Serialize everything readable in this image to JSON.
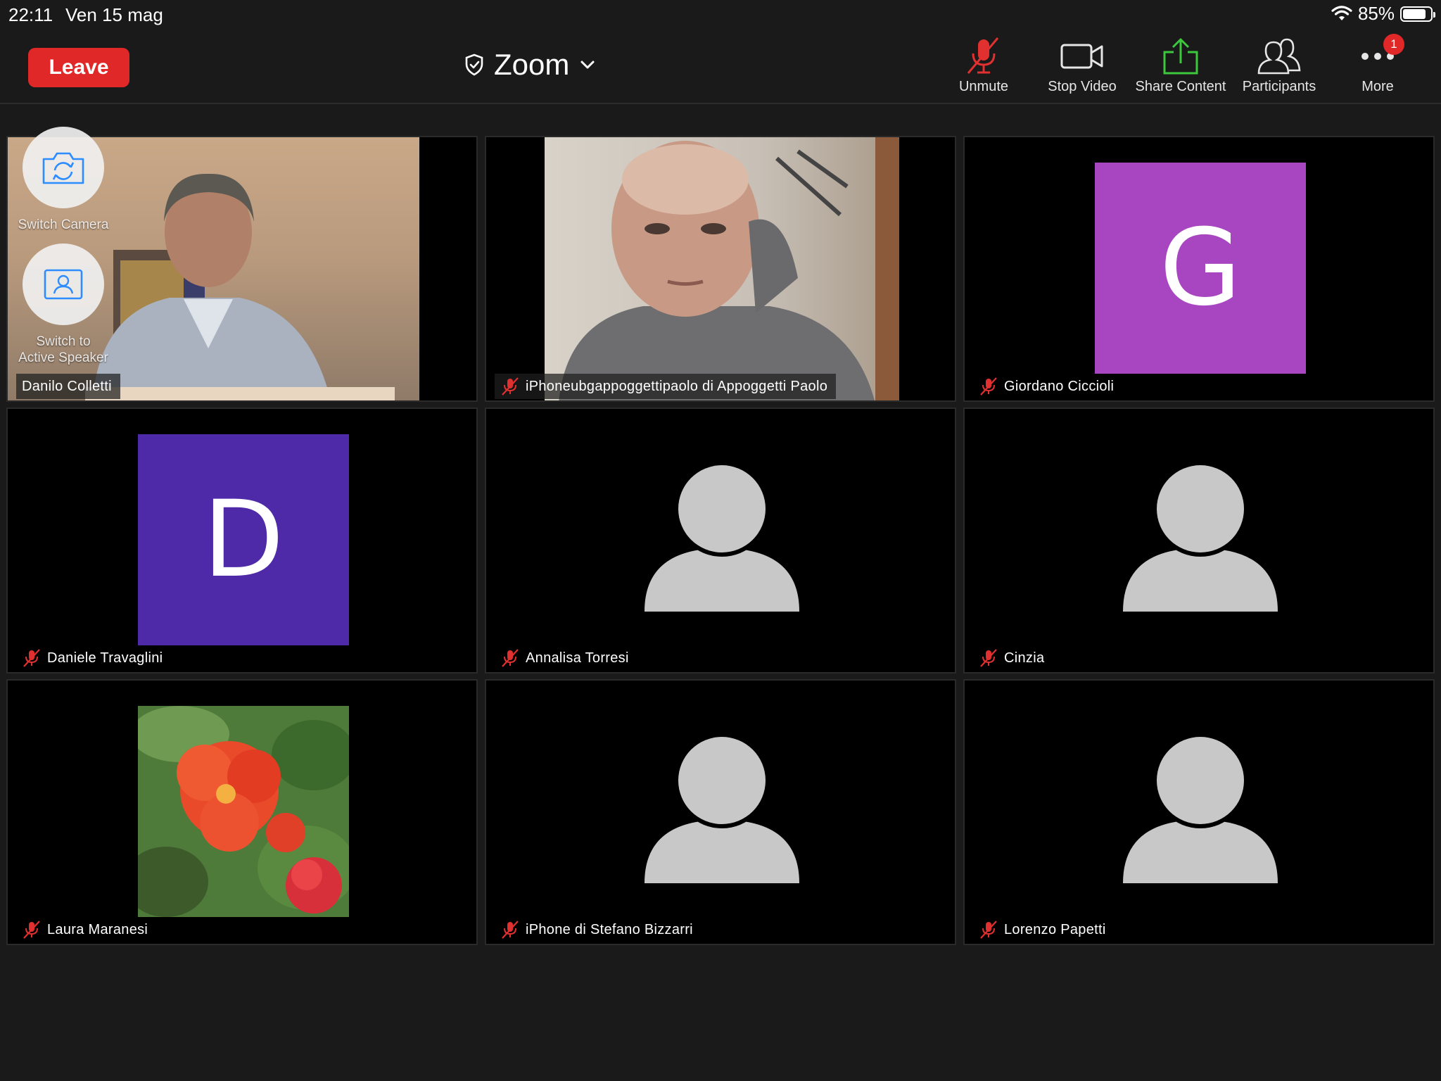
{
  "status_bar": {
    "time": "22:11",
    "date": "Ven 15 mag",
    "battery": "85%",
    "battery_level": 0.85
  },
  "toolbar": {
    "leave_label": "Leave",
    "meeting_title": "Zoom",
    "buttons": [
      {
        "id": "unmute",
        "label": "Unmute",
        "icon": "mic-muted-icon"
      },
      {
        "id": "stop-video",
        "label": "Stop Video",
        "icon": "video-camera-icon"
      },
      {
        "id": "share-content",
        "label": "Share Content",
        "icon": "share-upload-icon"
      },
      {
        "id": "participants",
        "label": "Participants",
        "icon": "participants-icon"
      },
      {
        "id": "more",
        "label": "More",
        "icon": "more-dots-icon",
        "badge": "1"
      }
    ]
  },
  "floating_controls": {
    "switch_camera": "Switch Camera",
    "switch_speaker_line1": "Switch to",
    "switch_speaker_line2": "Active Speaker"
  },
  "participants": [
    {
      "name": "Danilo Colletti",
      "muted": false,
      "display": "video"
    },
    {
      "name": "iPhoneubgappoggettipaolo di Appoggetti Paolo",
      "muted": true,
      "display": "video"
    },
    {
      "name": "Giordano Ciccioli",
      "muted": true,
      "display": "letter",
      "letter": "G",
      "color": "#a845c0"
    },
    {
      "name": "Daniele Travaglini",
      "muted": true,
      "display": "letter",
      "letter": "D",
      "color": "#4e2aa8"
    },
    {
      "name": "Annalisa Torresi",
      "muted": true,
      "display": "generic"
    },
    {
      "name": "Cinzia",
      "muted": true,
      "display": "generic"
    },
    {
      "name": "Laura Maranesi",
      "muted": true,
      "display": "photo"
    },
    {
      "name": "iPhone di Stefano Bizzarri",
      "muted": true,
      "display": "generic"
    },
    {
      "name": "Lorenzo Papetti",
      "muted": true,
      "display": "generic"
    }
  ],
  "colors": {
    "leave": "#e02828",
    "muted_icon": "#e03030",
    "share_icon": "#3cc83c",
    "background": "#1a1a1a",
    "tile": "#000000"
  }
}
